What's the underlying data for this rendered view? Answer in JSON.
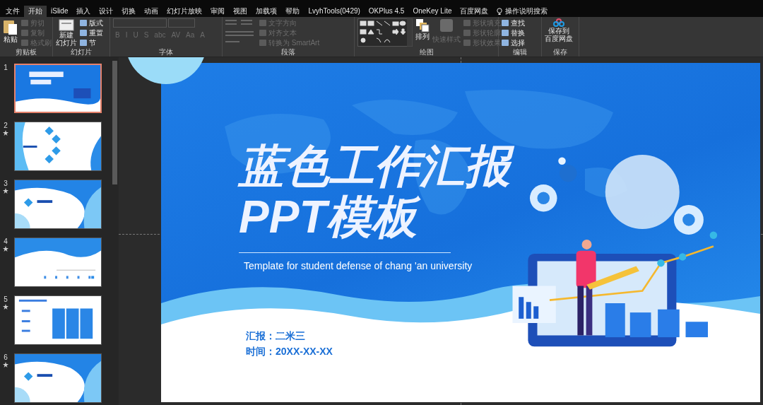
{
  "tabs": [
    {
      "label": "文件",
      "selected": false
    },
    {
      "label": "开始",
      "selected": true
    },
    {
      "label": "iSlide",
      "selected": false
    },
    {
      "label": "插入",
      "selected": false
    },
    {
      "label": "设计",
      "selected": false
    },
    {
      "label": "切换",
      "selected": false
    },
    {
      "label": "动画",
      "selected": false
    },
    {
      "label": "幻灯片放映",
      "selected": false
    },
    {
      "label": "审阅",
      "selected": false
    },
    {
      "label": "视图",
      "selected": false
    },
    {
      "label": "加载项",
      "selected": false
    },
    {
      "label": "帮助",
      "selected": false
    },
    {
      "label": "LvyhTools(0429)",
      "selected": false
    },
    {
      "label": "OKPlus 4.5",
      "selected": false
    },
    {
      "label": "OneKey Lite",
      "selected": false
    },
    {
      "label": "百度网盘",
      "selected": false
    }
  ],
  "tell_me": "操作说明搜索",
  "clipboard": {
    "label": "剪贴板",
    "paste": "粘贴",
    "items": [
      {
        "label": "剪切",
        "disabled": true
      },
      {
        "label": "复制",
        "disabled": true
      },
      {
        "label": "格式刷",
        "disabled": true
      }
    ]
  },
  "slides_group": {
    "label": "幻灯片",
    "new_slide": [
      "新建",
      "幻灯片"
    ],
    "items": [
      {
        "label": "版式",
        "disabled": false
      },
      {
        "label": "重置",
        "disabled": false
      },
      {
        "label": "节",
        "disabled": false
      }
    ]
  },
  "font": {
    "label": "字体",
    "disabled": true,
    "buttons": [
      "B",
      "I",
      "U",
      "S",
      "abc",
      "AV",
      "Aa",
      "A"
    ]
  },
  "paragraph": {
    "label": "段落",
    "items": [
      {
        "label": "文字方向",
        "disabled": true
      },
      {
        "label": "对齐文本",
        "disabled": true
      },
      {
        "label": "转换为 SmartArt",
        "disabled": true
      }
    ]
  },
  "drawing": {
    "label": "绘图",
    "arrange": "排列",
    "quick_styles": {
      "label": "快速样式",
      "disabled": true
    },
    "items": [
      {
        "label": "形状填充",
        "disabled": true
      },
      {
        "label": "形状轮廓",
        "disabled": true
      },
      {
        "label": "形状效果",
        "disabled": true
      }
    ]
  },
  "editing": {
    "label": "编辑",
    "items": [
      {
        "label": "查找",
        "disabled": false
      },
      {
        "label": "替换",
        "disabled": false
      },
      {
        "label": "选择",
        "disabled": false
      }
    ]
  },
  "save": {
    "label": "保存",
    "button": [
      "保存到",
      "百度网盘"
    ]
  },
  "slides": [
    {
      "number": "1",
      "kind": "title",
      "selected": true,
      "starred": false
    },
    {
      "number": "2",
      "kind": "contents",
      "selected": false,
      "starred": true
    },
    {
      "number": "3",
      "kind": "section",
      "selected": false,
      "starred": true
    },
    {
      "number": "4",
      "kind": "icons",
      "selected": false,
      "starred": true
    },
    {
      "number": "5",
      "kind": "columns",
      "selected": false,
      "starred": true
    },
    {
      "number": "6",
      "kind": "section",
      "selected": false,
      "starred": true
    }
  ],
  "slide": {
    "title_lines": [
      "蓝色工作汇报",
      "PPT模板"
    ],
    "subtitle": "Template for student defense of chang 'an university",
    "reporter": "汇报：二米三",
    "date": "时间：20XX-XX-XX"
  }
}
